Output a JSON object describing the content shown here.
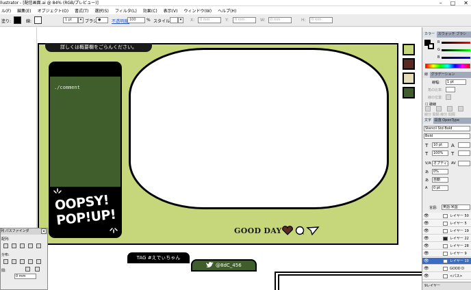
{
  "window": {
    "title": "llustrator - [配信画面.ai @ 84% (RGB/プレビュー)]",
    "controls": [
      "–",
      "□",
      "✕"
    ]
  },
  "menu": [
    "ル(F)",
    "編集(E)",
    "オブジェクト(O)",
    "書式(T)",
    "選択(S)",
    "フィルタ(L)",
    "効果(C)",
    "表示(V)",
    "ウィンドウ(W)",
    "ヘルプ(H)"
  ],
  "controlbar": {
    "fill_label": "塗り:",
    "stroke_label": "線:",
    "stroke_weight": "1 pt",
    "brush_label": "ブラシ:",
    "opacity_label": "不透明度:",
    "opacity_value": "100",
    "opacity_unit": "%",
    "style_label": "スタイル:",
    "x_label": "X:",
    "x_value": "0 mm",
    "y_label": "Y:",
    "y_value": "0 mm",
    "w_label": "W:",
    "w_value": "0 mm",
    "h_label": "H:",
    "h_value": "0 mm"
  },
  "artwork": {
    "top_label": "詳しくは概要欄をごらんください。",
    "comment_text": "./comment",
    "logo_line1": "OOPSY!",
    "logo_line2": "POP!UP!",
    "goodday": "GOOD DAY",
    "tag": "TAG #えでぃちゃん",
    "twitter_handle": "@8dC_456",
    "swatches": [
      "#c6d67a",
      "#5a2a22",
      "#e5dcb8",
      "#3f5e2b"
    ],
    "frame_color": "#c6d67a",
    "panel_color": "#3f5e2b"
  },
  "align_panel": {
    "tabs": "列 パスファインダ",
    "close": "✕",
    "row1_label": "配列:",
    "row2_label": "分布:",
    "row3_label": "間:",
    "spacing_value": "0 mm"
  },
  "right_panel": {
    "color_tab": "カラー",
    "swatch_tab": "スウォッチ",
    "brush_tab": "ブラシ",
    "r_label": "R",
    "g_label": "G",
    "b_label": "B",
    "stroke_tab": "線",
    "gradient_tab": "グラデーション",
    "stroke_weight_label": "線幅:",
    "stroke_weight_value": "1 pt",
    "cap_label": "角の比率:",
    "join_label": "線の位置:",
    "dash_label": "破線",
    "dash_fields": [
      "線分",
      "間隔",
      "線分",
      "間隔",
      "線分",
      "間隔"
    ],
    "char_tab": "文字",
    "para_tab": "段落",
    "opentype_tab": "OpenType",
    "font_name": "Stencil Std Bold",
    "font_style": "Bold",
    "size_value": "10 pt",
    "scale_value": "100%",
    "tracking_value": "オプティカル",
    "kerning_value": "0%",
    "leading_value": "自動",
    "baseline_value": "0 pt",
    "lang_label": "言語:",
    "lang_value": "英語:米国",
    "layers": [
      {
        "name": "レイヤー 50",
        "selected": false
      },
      {
        "name": "レイヤー 5",
        "selected": false
      },
      {
        "name": "レイヤー 19",
        "selected": false
      },
      {
        "name": "レイヤー 22",
        "selected": false
      },
      {
        "name": "レイヤー 28",
        "selected": false
      },
      {
        "name": "レイヤー 9",
        "selected": false
      },
      {
        "name": "レイヤー 10",
        "selected": true
      },
      {
        "name": "GOOD D",
        "selected": false
      },
      {
        "name": "<パス>",
        "selected": false
      }
    ],
    "layers_footer": "9レイヤー"
  }
}
